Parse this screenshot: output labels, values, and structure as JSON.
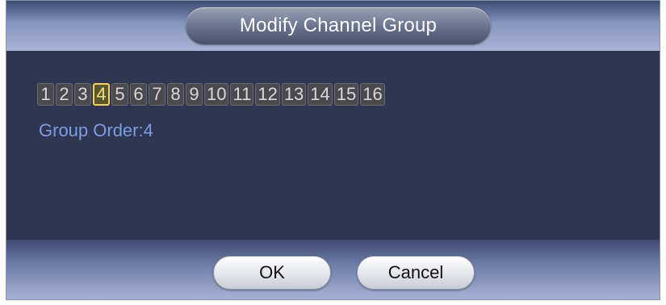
{
  "dialog": {
    "title": "Modify Channel Group"
  },
  "channels": {
    "items": [
      "1",
      "2",
      "3",
      "4",
      "5",
      "6",
      "7",
      "8",
      "9",
      "10",
      "11",
      "12",
      "13",
      "14",
      "15",
      "16"
    ],
    "selected": "4"
  },
  "group_order": {
    "text": "Group Order:4"
  },
  "buttons": {
    "ok_label": "OK",
    "cancel_label": "Cancel"
  },
  "colors": {
    "panel_bg": "#2e3651",
    "selected_border": "#f3d35a",
    "label_text": "#7e9ce4"
  }
}
